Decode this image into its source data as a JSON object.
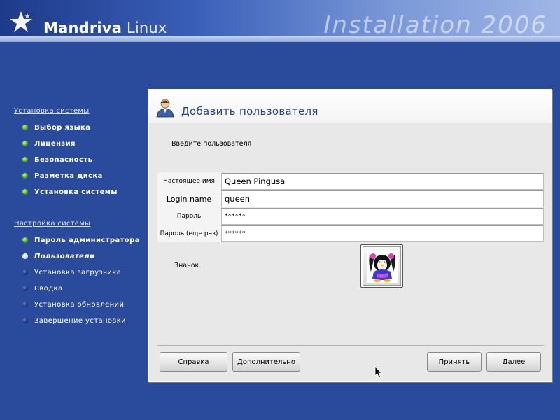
{
  "banner": {
    "logo_brand": "Mandriva",
    "logo_product": " Linux",
    "title": "Installation 2006"
  },
  "sidebar": {
    "section1": {
      "title": "Установка системы",
      "steps": [
        {
          "label": "Выбор языка",
          "state": "done"
        },
        {
          "label": "Лицензия",
          "state": "done"
        },
        {
          "label": "Безопасность",
          "state": "done"
        },
        {
          "label": "Разметка диска",
          "state": "done"
        },
        {
          "label": "Установка системы",
          "state": "done"
        }
      ]
    },
    "section2": {
      "title": "Настройка системы",
      "steps": [
        {
          "label": "Пароль администратора",
          "state": "done"
        },
        {
          "label": "Пользователи",
          "state": "current"
        },
        {
          "label": "Установка загрузчика",
          "state": "todo"
        },
        {
          "label": "Сводка",
          "state": "todo"
        },
        {
          "label": "Установка обновлений",
          "state": "todo"
        },
        {
          "label": "Завершение установки",
          "state": "todo"
        }
      ]
    }
  },
  "dialog": {
    "title": "Добавить пользователя",
    "prompt": "Введите пользователя",
    "fields": {
      "real_name": {
        "label": "Настоящее имя",
        "value": "Queen Pingusa"
      },
      "login": {
        "label": "Login name",
        "value": "queen"
      },
      "password": {
        "label": "Пароль",
        "value": "******"
      },
      "password_again": {
        "label": "Пароль (еще раз)",
        "value": "******"
      }
    },
    "icon_label": "Значок",
    "buttons": {
      "help": "Справка",
      "advanced": "Дополнительно",
      "accept": "Принять",
      "next": "Далее"
    }
  },
  "colors": {
    "background": "#2a4a9c",
    "title_blue": "#26448c",
    "done_dot": "#4aa316",
    "todo_dot": "#1b2f78"
  }
}
